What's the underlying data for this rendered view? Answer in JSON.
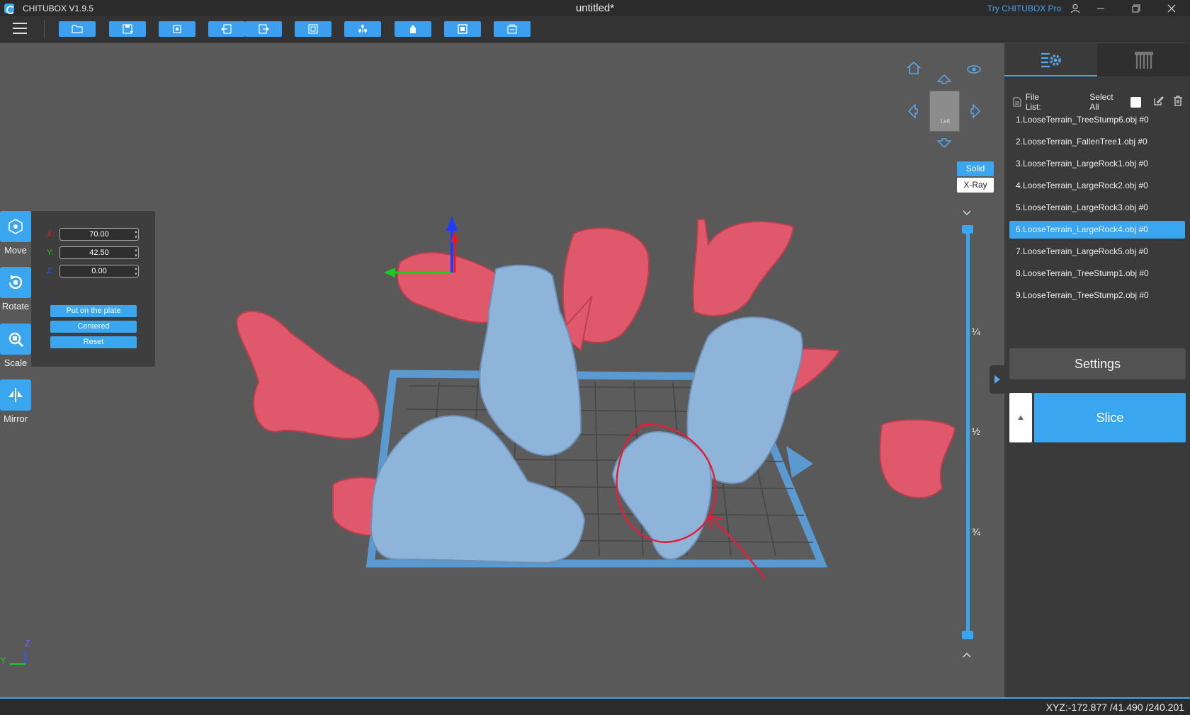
{
  "titlebar": {
    "app_name": "CHITUBOX V1.9.5",
    "document_title": "untitled*",
    "pro_link": "Try CHITUBOX Pro"
  },
  "toolbar": {
    "buttons": [
      "open-file-icon",
      "save-icon",
      "auto-layout-icon",
      "undo-icon",
      "redo-icon",
      "copy-icon",
      "supports-icon",
      "hollow-icon",
      "fill-icon",
      "print-settings-icon"
    ]
  },
  "tools": {
    "move": "Move",
    "rotate": "Rotate",
    "scale": "Scale",
    "mirror": "Mirror"
  },
  "move_panel": {
    "x_label": "X:",
    "y_label": "Y:",
    "z_label": "Z:",
    "x_value": "70.00",
    "y_value": "42.50",
    "z_value": "0.00",
    "put_on_plate": "Put on the plate",
    "centered": "Centered",
    "reset": "Reset"
  },
  "view": {
    "cube_face": "Left",
    "solid": "Solid",
    "xray": "X-Ray",
    "fractions": [
      "¼",
      "½",
      "¾"
    ]
  },
  "side_panel": {
    "file_list_label": "File List:",
    "select_all": "Select All",
    "files": [
      "1.LooseTerrain_TreeStump6.obj #0",
      "2.LooseTerrain_FallenTree1.obj #0",
      "3.LooseTerrain_LargeRock1.obj #0",
      "4.LooseTerrain_LargeRock2.obj #0",
      "5.LooseTerrain_LargeRock3.obj #0",
      "6.LooseTerrain_LargeRock4.obj #0",
      "7.LooseTerrain_LargeRock5.obj #0",
      "8.LooseTerrain_TreeStump1.obj #0",
      "9.LooseTerrain_TreeStump2.obj #0"
    ],
    "selected_index": 5,
    "settings": "Settings",
    "slice": "Slice"
  },
  "axis_gizmo": {
    "y": "Y",
    "z": "Z"
  },
  "status": {
    "coords": "XYZ:-172.877 /41.490 /240.201"
  },
  "colors": {
    "accent": "#3aa6f0",
    "model_selected": "#e0596b",
    "model_normal": "#8fb4d9",
    "plate": "#5b9ad0"
  }
}
